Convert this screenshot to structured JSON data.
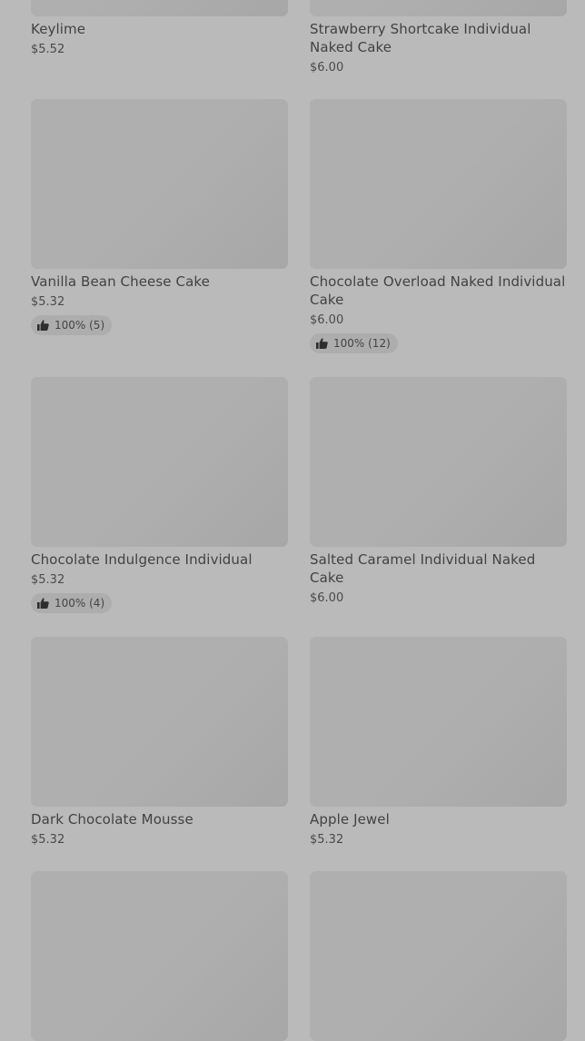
{
  "products": [
    {
      "name": "Keylime",
      "price": "$5.52"
    },
    {
      "name": "Strawberry Shortcake Individual Naked Cake",
      "price": "$6.00"
    },
    {
      "name": "Vanilla Bean Cheese Cake",
      "price": "$5.32",
      "rating": "100% (5)"
    },
    {
      "name": "Chocolate Overload Naked Individual Cake",
      "price": "$6.00",
      "rating": "100% (12)"
    },
    {
      "name": "Chocolate Indulgence Individual",
      "price": "$5.32",
      "rating": "100% (4)"
    },
    {
      "name": "Salted Caramel Individual Naked Cake",
      "price": "$6.00"
    },
    {
      "name": "Dark Chocolate Mousse",
      "price": "$5.32"
    },
    {
      "name": "Apple Jewel",
      "price": "$5.32"
    }
  ],
  "icons": {
    "rating": "thumbs-up-icon"
  }
}
